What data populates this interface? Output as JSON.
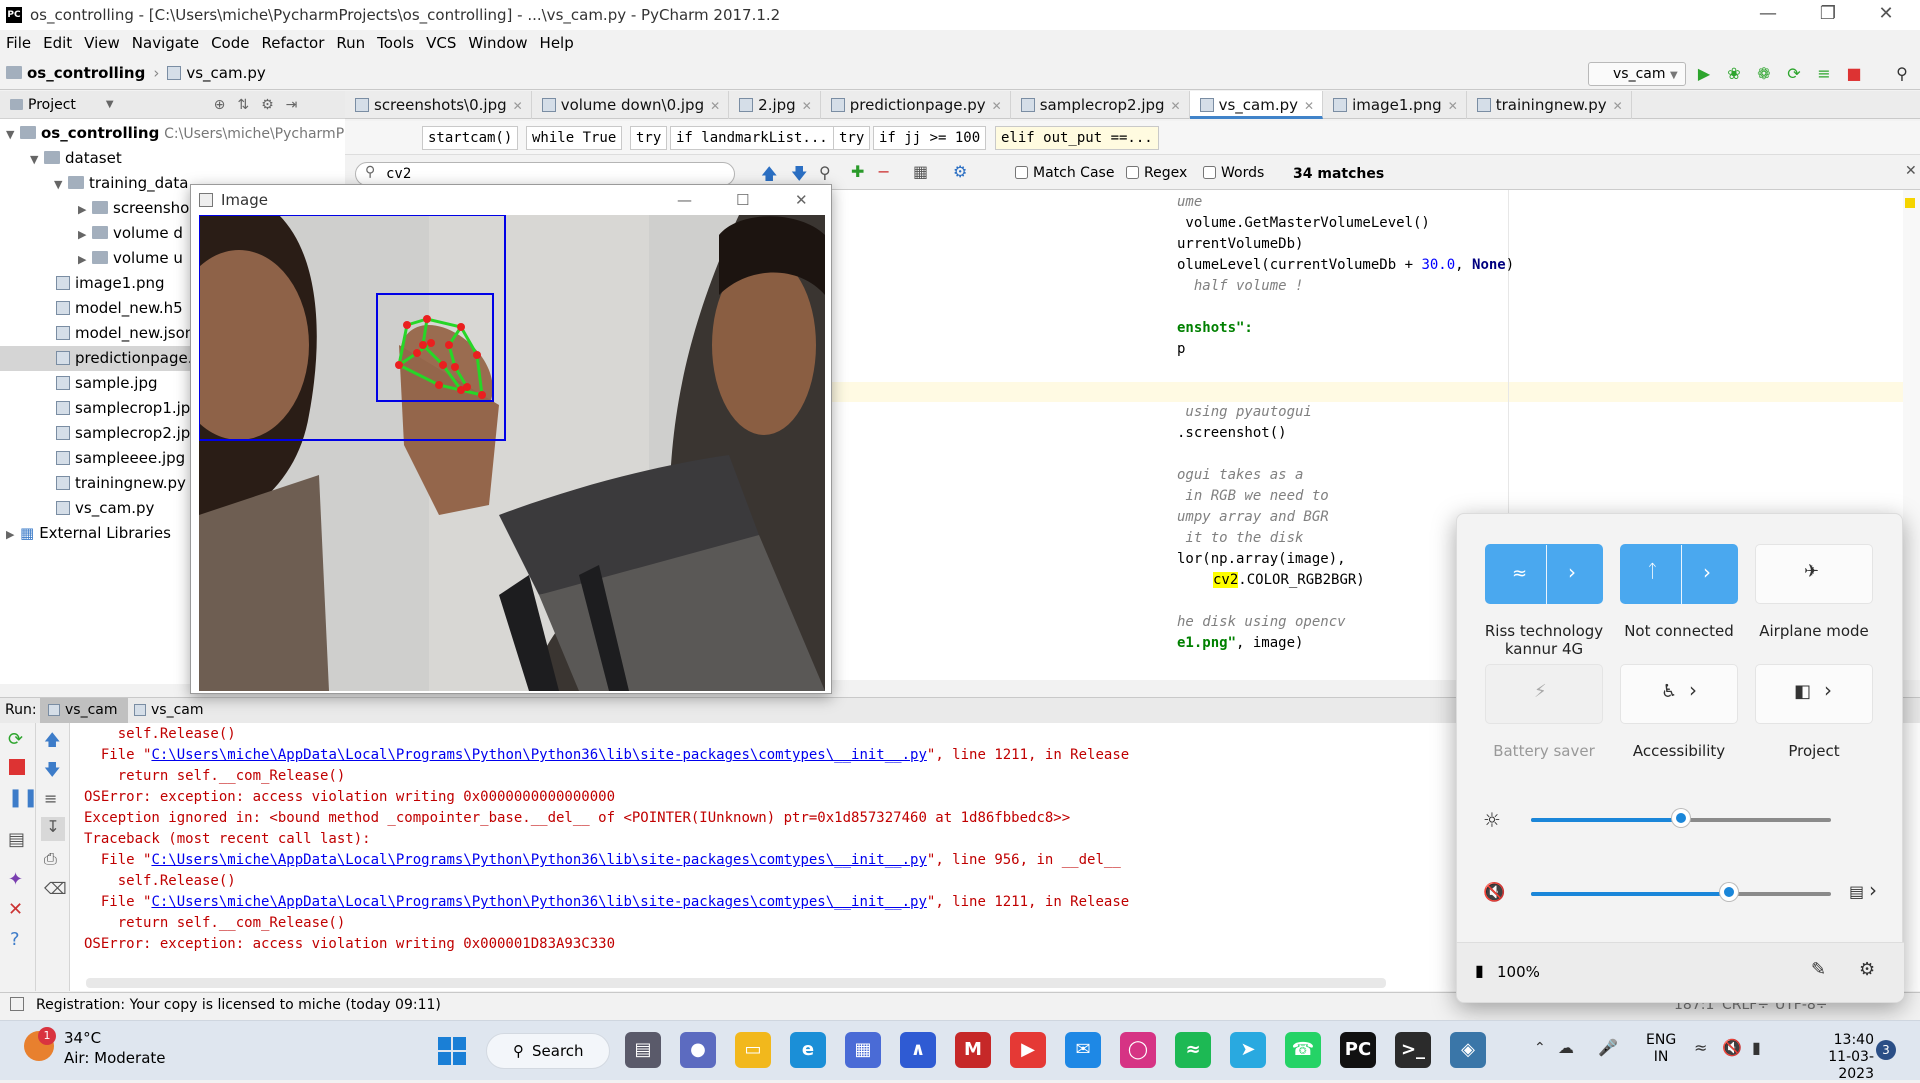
{
  "window": {
    "title": "os_controlling - [C:\\Users\\miche\\PycharmProjects\\os_controlling] - ...\\vs_cam.py - PyCharm 2017.1.2"
  },
  "menu": [
    "File",
    "Edit",
    "View",
    "Navigate",
    "Code",
    "Refactor",
    "Run",
    "Tools",
    "VCS",
    "Window",
    "Help"
  ],
  "nav": {
    "project": "os_controlling",
    "file": "vs_cam.py",
    "run_config": "vs_cam"
  },
  "project_panel": {
    "header": "Project",
    "root": "os_controlling",
    "root_path": "C:\\Users\\miche\\PycharmProj",
    "items": [
      "dataset",
      "training_data",
      "screensho",
      "volume d",
      "volume u",
      "image1.png",
      "model_new.h5",
      "model_new.json",
      "predictionpage.p",
      "sample.jpg",
      "samplecrop1.jpg",
      "samplecrop2.jpg",
      "sampleeee.jpg",
      "trainingnew.py",
      "vs_cam.py",
      "External Libraries"
    ]
  },
  "tabs": [
    "screenshots\\0.jpg",
    "volume down\\0.jpg",
    "2.jpg",
    "predictionpage.py",
    "samplecrop2.jpg",
    "vs_cam.py",
    "image1.png",
    "trainingnew.py"
  ],
  "breadcrumbs": [
    "startcam()",
    "while True",
    "try",
    "if landmarkList...",
    "try",
    "if jj >= 100",
    "elif out_put ==..."
  ],
  "find": {
    "query": "cv2",
    "match_case": "Match Case",
    "regex": "Regex",
    "words": "Words",
    "matches": "34 matches"
  },
  "code": {
    "l1": "ume",
    "l2": " volume.GetMasterVolumeLevel()",
    "l3": "urrentVolumeDb)",
    "l4a": "olumeLevel(currentVolumeDb + ",
    "l4n": "30.0",
    "l4b": ", ",
    "l4k": "None",
    "l4c": ")",
    "l5": "  half volume !",
    "l6": "enshots\":",
    "l7": "p",
    "l8": " using pyautogui",
    "l9": ".screenshot()",
    "l10": "ogui takes as a",
    "l11": " in RGB we need to",
    "l12": "umpy array and BGR",
    "l13": " it to the disk",
    "l14": "lor(np.array(image),",
    "l15a": "cv2",
    "l15b": ".COLOR_RGB2BGR)",
    "l16": "he disk using opencv",
    "l17a": "e1.png\"",
    "l17b": ", image)"
  },
  "image_window": {
    "title": "Image"
  },
  "run": {
    "label": "Run:",
    "tabs": [
      "vs_cam",
      "vs_cam"
    ],
    "lines": [
      {
        "pre": "    self.Release()",
        "link": "",
        "post": ""
      },
      {
        "pre": "  File \"",
        "link": "C:\\Users\\miche\\AppData\\Local\\Programs\\Python\\Python36\\lib\\site-packages\\comtypes\\__init__.py",
        "post": "\", line 1211, in Release"
      },
      {
        "pre": "    return self.__com_Release()",
        "link": "",
        "post": ""
      },
      {
        "pre": "OSError: exception: access violation writing 0x0000000000000000",
        "link": "",
        "post": ""
      },
      {
        "pre": "Exception ignored in: <bound method _compointer_base.__del__ of <POINTER(IUnknown) ptr=0x1d857327460 at 1d86fbbedc8>>",
        "link": "",
        "post": ""
      },
      {
        "pre": "Traceback (most recent call last):",
        "link": "",
        "post": ""
      },
      {
        "pre": "  File \"",
        "link": "C:\\Users\\miche\\AppData\\Local\\Programs\\Python\\Python36\\lib\\site-packages\\comtypes\\__init__.py",
        "post": "\", line 956, in __del__"
      },
      {
        "pre": "    self.Release()",
        "link": "",
        "post": ""
      },
      {
        "pre": "  File \"",
        "link": "C:\\Users\\miche\\AppData\\Local\\Programs\\Python\\Python36\\lib\\site-packages\\comtypes\\__init__.py",
        "post": "\", line 1211, in Release"
      },
      {
        "pre": "    return self.__com_Release()",
        "link": "",
        "post": ""
      },
      {
        "pre": "OSError: exception: access violation writing 0x000001D83A93C330",
        "link": "",
        "post": ""
      }
    ]
  },
  "status": {
    "message": "Registration: Your copy is licensed to miche (today 09:11)",
    "position": "187:1",
    "line_sep": "CRLF÷",
    "encoding": "UTF-8÷"
  },
  "quick_settings": {
    "wifi_label": "Riss technology kannur 4G",
    "bt_label": "Not connected",
    "airplane_label": "Airplane mode",
    "battery_saver_label": "Battery saver",
    "accessibility_label": "Accessibility",
    "project_label": "Project",
    "brightness": 0.5,
    "volume": 0.66,
    "battery": "100%"
  },
  "taskbar": {
    "weather_temp": "34°C",
    "weather_desc": "Air: Moderate",
    "weather_badge": "1",
    "search": "Search",
    "lang1": "ENG",
    "lang2": "IN",
    "time": "13:40",
    "date": "11-03-2023",
    "notif_count": "3"
  },
  "colors": {
    "accent": "#4aa8ef",
    "slider": "#1a86d9",
    "error": "#c00000",
    "highlight": "#ffff00"
  }
}
